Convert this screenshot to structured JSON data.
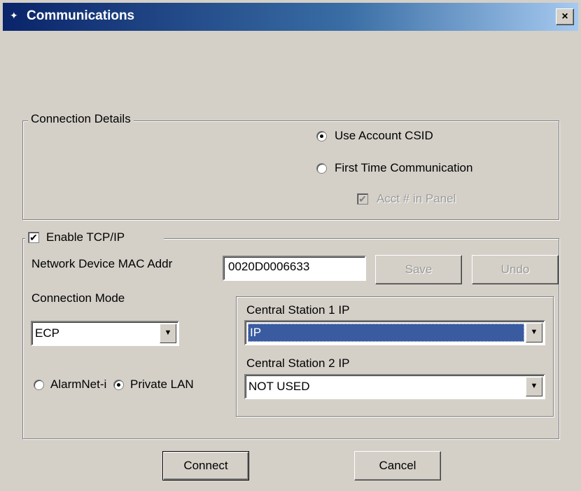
{
  "window": {
    "title": "Communications",
    "close_label": "×"
  },
  "connection_details": {
    "legend": "Connection Details",
    "use_account_csid": {
      "label": "Use Account CSID",
      "selected": true
    },
    "first_time_communication": {
      "label": "First Time Communication",
      "selected": false
    },
    "acct_in_panel": {
      "label": "Acct # in Panel",
      "checked": true,
      "disabled": true
    }
  },
  "tcpip": {
    "enable_label": "Enable TCP/IP",
    "enable_checked": true,
    "mac_label": "Network Device MAC Addr",
    "mac_value": "0020D0006633",
    "save_label": "Save",
    "undo_label": "Undo",
    "connection_mode_label": "Connection Mode",
    "connection_mode_value": "ECP",
    "alarmnet_label": "AlarmNet-i",
    "private_lan_label": "Private LAN",
    "mode_selected": "Private LAN",
    "cs1_label": "Central Station 1 IP",
    "cs1_value": "IP",
    "cs2_label": "Central Station 2 IP",
    "cs2_value": "NOT USED"
  },
  "footer": {
    "connect_label": "Connect",
    "cancel_label": "Cancel"
  }
}
